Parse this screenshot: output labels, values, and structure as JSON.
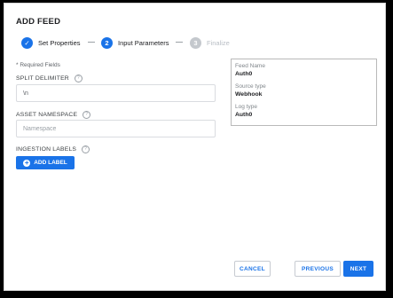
{
  "dialog": {
    "title": "ADD FEED",
    "steps": [
      {
        "number": "✓",
        "label": "Set Properties",
        "state": "complete",
        "color": "#1a73e8"
      },
      {
        "number": "2",
        "label": "Input Parameters",
        "state": "active",
        "color": "#1a73e8"
      },
      {
        "number": "3",
        "label": "Finalize",
        "state": "pending",
        "color": "#c4c8cd"
      }
    ],
    "required_note": "* Required Fields",
    "fields": {
      "split_delimiter": {
        "label": "SPLIT DELIMITER",
        "value": "\\n",
        "help_icon": "help-circle-icon"
      },
      "asset_namespace": {
        "label": "ASSET NAMESPACE",
        "value": "",
        "placeholder": "Namespace",
        "help_icon": "help-circle-icon"
      },
      "ingestion_labels": {
        "label": "INGESTION LABELS",
        "help_icon": "help-circle-icon"
      }
    },
    "add_label_button": {
      "label": "ADD LABEL",
      "icon": "plus-circle-icon"
    },
    "summary": {
      "feed_name_label": "Feed Name",
      "feed_name": "Auth0",
      "source_type_label": "Source type",
      "source_type": "Webhook",
      "log_type_label": "Log type",
      "log_type": "Auth0"
    },
    "footer": {
      "cancel": "CANCEL",
      "previous": "PREVIOUS",
      "next": "NEXT"
    },
    "colors": {
      "accent": "#1a73e8",
      "muted_step": "#c4c8cd"
    }
  }
}
